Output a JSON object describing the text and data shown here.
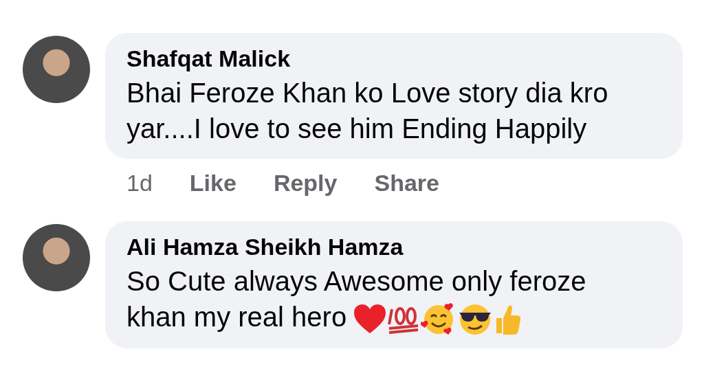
{
  "comments": [
    {
      "name": "Shafqat Malick",
      "text": "Bhai Feroze Khan ko Love story dia kro yar....I love to see him Ending Happily",
      "time": "1d",
      "actions": [
        {
          "label": "Like"
        },
        {
          "label": "Reply"
        },
        {
          "label": "Share"
        }
      ]
    },
    {
      "name": "Ali Hamza Sheikh Hamza",
      "text": "So Cute always Awesome only feroze khan my real hero"
    }
  ]
}
